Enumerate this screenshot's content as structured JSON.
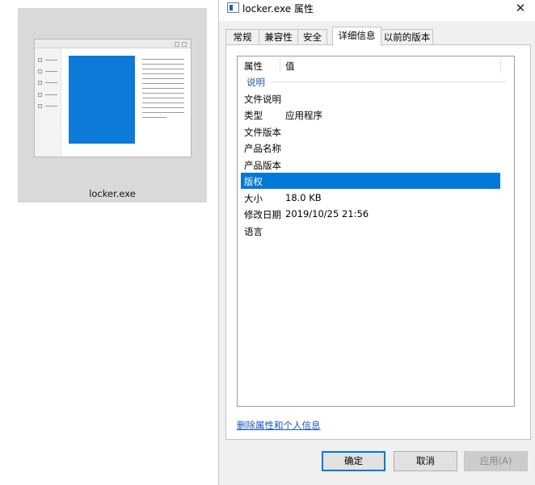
{
  "thumbnail": {
    "file_name": "locker.exe",
    "icon": "document-preview-icon"
  },
  "dialog": {
    "title": "locker.exe 属性",
    "title_icon": "exe-file-icon",
    "close_glyph": "✕",
    "tabs": [
      {
        "label": "常规"
      },
      {
        "label": "兼容性"
      },
      {
        "label": "安全"
      },
      {
        "label": "详细信息",
        "active": true
      },
      {
        "label": "以前的版本"
      }
    ],
    "details": {
      "header_property": "属性",
      "header_value": "值",
      "group": "说明",
      "rows": [
        {
          "name": "文件说明",
          "value": ""
        },
        {
          "name": "类型",
          "value": "应用程序"
        },
        {
          "name": "文件版本",
          "value": ""
        },
        {
          "name": "产品名称",
          "value": ""
        },
        {
          "name": "产品版本",
          "value": ""
        },
        {
          "name": "版权",
          "value": "",
          "selected": true
        },
        {
          "name": "大小",
          "value": "18.0 KB"
        },
        {
          "name": "修改日期",
          "value": "2019/10/25 21:56"
        },
        {
          "name": "语言",
          "value": ""
        }
      ]
    },
    "remove_link": "删除属性和个人信息",
    "buttons": {
      "ok": "确定",
      "cancel": "取消",
      "apply": "应用(A)"
    },
    "colors": {
      "selection": "#0078d7",
      "link": "#1a56c4",
      "group_label": "#1e5aa8"
    }
  }
}
